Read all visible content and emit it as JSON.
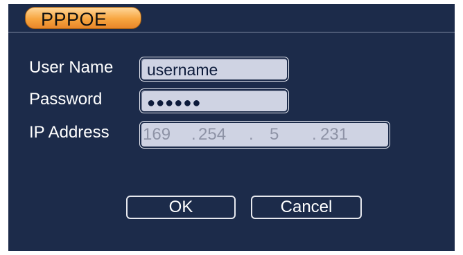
{
  "dialog": {
    "tab_title": "PPPOE"
  },
  "form": {
    "username_label": "User Name",
    "username_value": "username",
    "password_label": "Password",
    "password_value": "●●●●●●",
    "ip_label": "IP Address",
    "ip_octets": [
      "169",
      "254",
      "5",
      "231"
    ]
  },
  "buttons": {
    "ok_label": "OK",
    "cancel_label": "Cancel"
  },
  "colors": {
    "dialog_background": "#1c2b4a",
    "tab_accent": "#f7a53f",
    "field_background": "#cfd3e3",
    "disabled_text": "#8e93a6"
  }
}
